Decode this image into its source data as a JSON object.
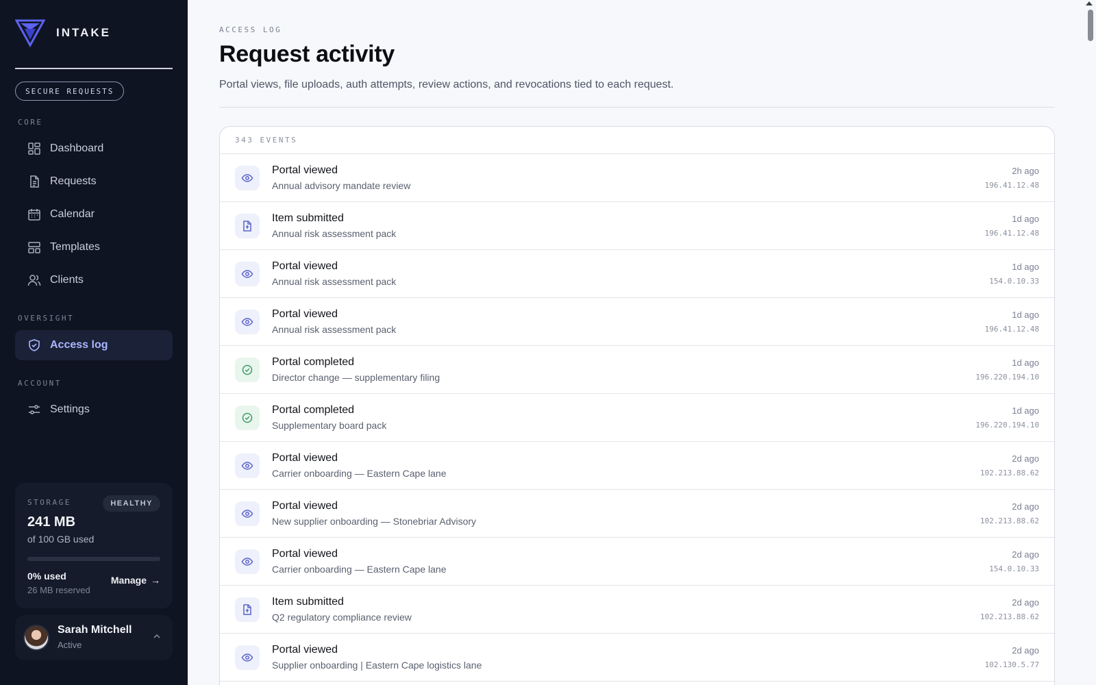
{
  "brand": {
    "name": "INTAKE"
  },
  "badge": "SECURE REQUESTS",
  "nav": {
    "core_label": "CORE",
    "core_items": [
      {
        "label": "Dashboard",
        "icon": "dashboard-icon"
      },
      {
        "label": "Requests",
        "icon": "document-icon"
      },
      {
        "label": "Calendar",
        "icon": "calendar-icon"
      },
      {
        "label": "Templates",
        "icon": "templates-icon"
      },
      {
        "label": "Clients",
        "icon": "users-icon"
      }
    ],
    "oversight_label": "OVERSIGHT",
    "oversight_items": [
      {
        "label": "Access log",
        "icon": "shield-check-icon",
        "active": true
      }
    ],
    "account_label": "ACCOUNT",
    "account_items": [
      {
        "label": "Settings",
        "icon": "sliders-icon"
      }
    ]
  },
  "storage": {
    "label": "STORAGE",
    "status": "HEALTHY",
    "amount": "241 MB",
    "of_total": "of 100 GB used",
    "used_fraction": 0.0,
    "percent_text": "0% used",
    "reserved": "26 MB reserved",
    "manage_label": "Manage",
    "accent": "#6e7bff"
  },
  "user": {
    "name": "Sarah Mitchell",
    "status": "Active"
  },
  "page": {
    "eyebrow": "ACCESS LOG",
    "title": "Request activity",
    "subtitle": "Portal views, file uploads, auth attempts, review actions, and revocations tied to each request."
  },
  "events": {
    "count_label": "343 EVENTS",
    "rows": [
      {
        "type": "view",
        "title": "Portal viewed",
        "subtitle": "Annual advisory mandate review",
        "time": "2h ago",
        "ip": "196.41.12.48"
      },
      {
        "type": "file",
        "title": "Item submitted",
        "subtitle": "Annual risk assessment pack",
        "time": "1d ago",
        "ip": "196.41.12.48"
      },
      {
        "type": "view",
        "title": "Portal viewed",
        "subtitle": "Annual risk assessment pack",
        "time": "1d ago",
        "ip": "154.0.10.33"
      },
      {
        "type": "view",
        "title": "Portal viewed",
        "subtitle": "Annual risk assessment pack",
        "time": "1d ago",
        "ip": "196.41.12.48"
      },
      {
        "type": "done",
        "title": "Portal completed",
        "subtitle": "Director change — supplementary filing",
        "time": "1d ago",
        "ip": "196.220.194.10"
      },
      {
        "type": "done",
        "title": "Portal completed",
        "subtitle": "Supplementary board pack",
        "time": "1d ago",
        "ip": "196.220.194.10"
      },
      {
        "type": "view",
        "title": "Portal viewed",
        "subtitle": "Carrier onboarding — Eastern Cape lane",
        "time": "2d ago",
        "ip": "102.213.88.62"
      },
      {
        "type": "view",
        "title": "Portal viewed",
        "subtitle": "New supplier onboarding — Stonebriar Advisory",
        "time": "2d ago",
        "ip": "102.213.88.62"
      },
      {
        "type": "view",
        "title": "Portal viewed",
        "subtitle": "Carrier onboarding — Eastern Cape lane",
        "time": "2d ago",
        "ip": "154.0.10.33"
      },
      {
        "type": "file",
        "title": "Item submitted",
        "subtitle": "Q2 regulatory compliance review",
        "time": "2d ago",
        "ip": "102.213.88.62"
      },
      {
        "type": "view",
        "title": "Portal viewed",
        "subtitle": "Supplier onboarding | Eastern Cape logistics lane",
        "time": "2d ago",
        "ip": "102.130.5.77"
      }
    ]
  },
  "colors": {
    "sidebar_bg": "#0f1422",
    "active_accent": "#aab7ff",
    "view_icon": "#5a63c9",
    "done_icon": "#3f9a63"
  }
}
